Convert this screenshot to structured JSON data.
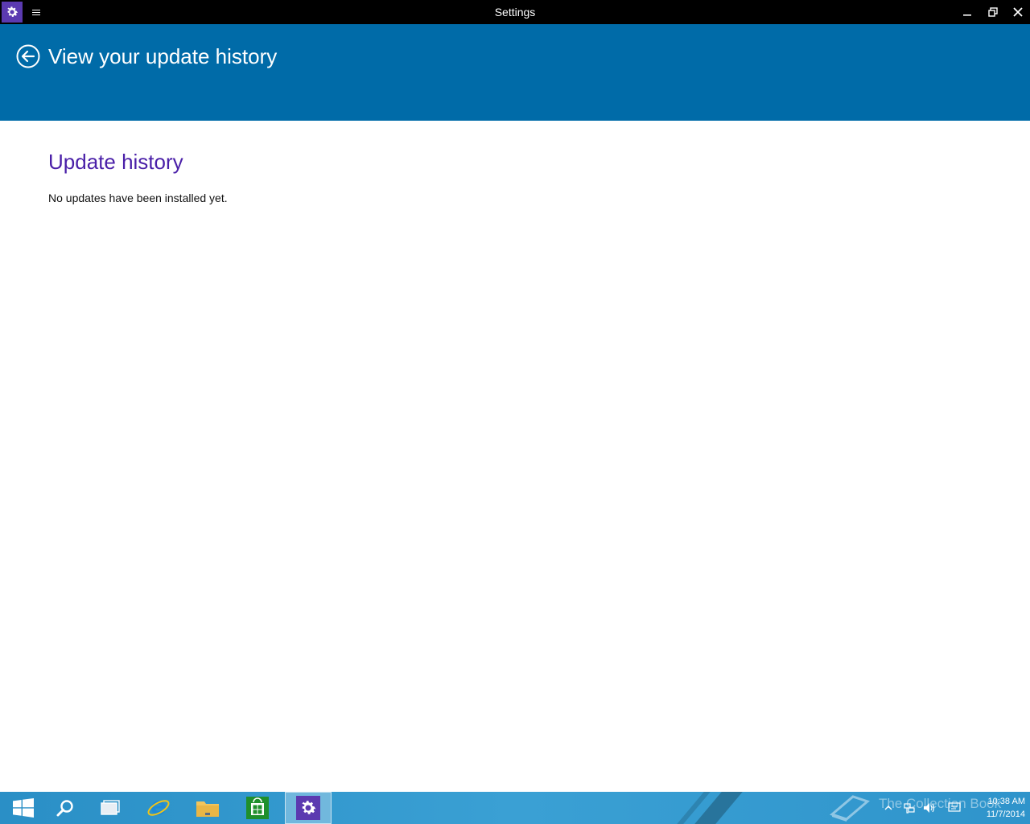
{
  "window": {
    "title": "Settings",
    "app_icon": "settings-gear-icon",
    "menu_icon": "hamburger-icon",
    "controls": [
      "minimize-icon",
      "restore-icon",
      "close-icon"
    ]
  },
  "header": {
    "back_icon": "back-arrow-icon",
    "title": "View your update history",
    "background": "#006ba8"
  },
  "content": {
    "section_title": "Update history",
    "status_text": "No updates have been installed yet.",
    "title_color": "#4a1fa8"
  },
  "taskbar": {
    "items": [
      {
        "name": "start",
        "icon": "windows-logo-icon"
      },
      {
        "name": "search",
        "icon": "search-icon"
      },
      {
        "name": "task-view",
        "icon": "task-view-icon"
      },
      {
        "name": "internet-explorer",
        "icon": "internet-explorer-icon"
      },
      {
        "name": "file-explorer",
        "icon": "folder-icon"
      },
      {
        "name": "store",
        "icon": "store-icon"
      },
      {
        "name": "settings",
        "icon": "settings-gear-icon",
        "active": true
      }
    ],
    "watermark": "The Collection Book",
    "tray_icons": [
      "chevron-up-icon",
      "network-icon",
      "volume-icon",
      "action-center-icon"
    ],
    "clock": {
      "time": "10:38 AM",
      "date": "11/7/2014"
    }
  }
}
